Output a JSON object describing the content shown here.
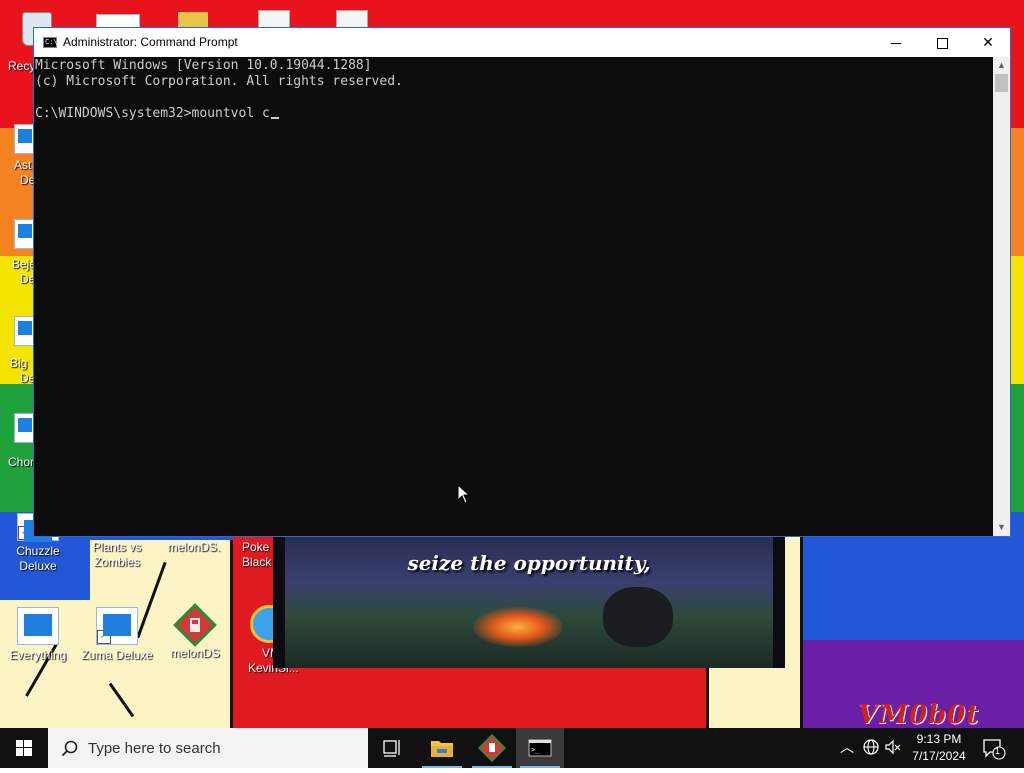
{
  "window": {
    "title": "Administrator: Command Prompt",
    "icon_glyph": "C:\\",
    "lines": [
      "Microsoft Windows [Version 10.0.19044.1288]",
      "(c) Microsoft Corporation. All rights reserved.",
      "",
      "C:\\WINDOWS\\system32>mountvol c"
    ]
  },
  "desktop_icons": {
    "left_partial": [
      "Recy",
      "Ast",
      "De",
      "Beje",
      "De",
      "Big",
      "De",
      "Chor"
    ],
    "chuzzle": "Chuzzle Deluxe",
    "plants": "Plants vs Zombies",
    "melon_partial": "melonDS.",
    "poke": "Poke Black",
    "everything": "Everything",
    "zuma": "Zuma Deluxe",
    "melonds": "melonDS",
    "vm": "VM KevinSi..."
  },
  "video": {
    "caption": "seize the opportunity,"
  },
  "watermark": "VM0b0t",
  "taskbar": {
    "search_placeholder": "Type here to search",
    "time": "9:13 PM",
    "date": "7/17/2024",
    "notification_count": "1",
    "accent": "#76b9ed"
  },
  "colors": {
    "console_bg": "#0c0c0c",
    "console_fg": "#cccccc"
  }
}
